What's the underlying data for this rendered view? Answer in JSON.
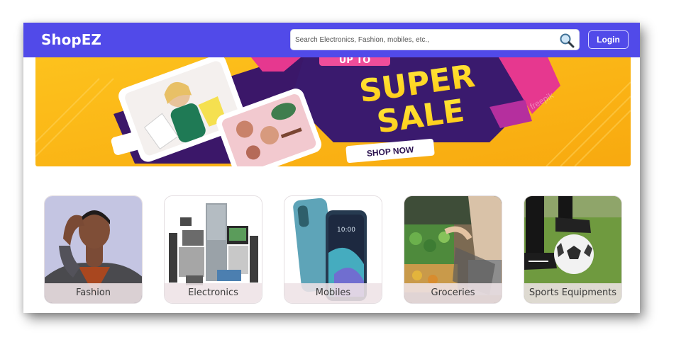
{
  "header": {
    "brand": "ShopEZ",
    "search_placeholder": "Search Electronics, Fashion, mobiles, etc.,",
    "login_label": "Login"
  },
  "banner": {
    "headline_line1": "SUPER",
    "headline_line2": "SALE",
    "cta_label": "SHOP NOW",
    "top_text": "UP TO",
    "watermark": "freepik"
  },
  "categories": [
    {
      "label": "Fashion"
    },
    {
      "label": "Electronics"
    },
    {
      "label": "Mobiles"
    },
    {
      "label": "Groceries"
    },
    {
      "label": "Sports Equipments"
    }
  ],
  "colors": {
    "navbar": "#514ae9",
    "banner_yellow": "#fbb819",
    "banner_purple": "#3c1a6b",
    "banner_pink": "#e6388f"
  }
}
